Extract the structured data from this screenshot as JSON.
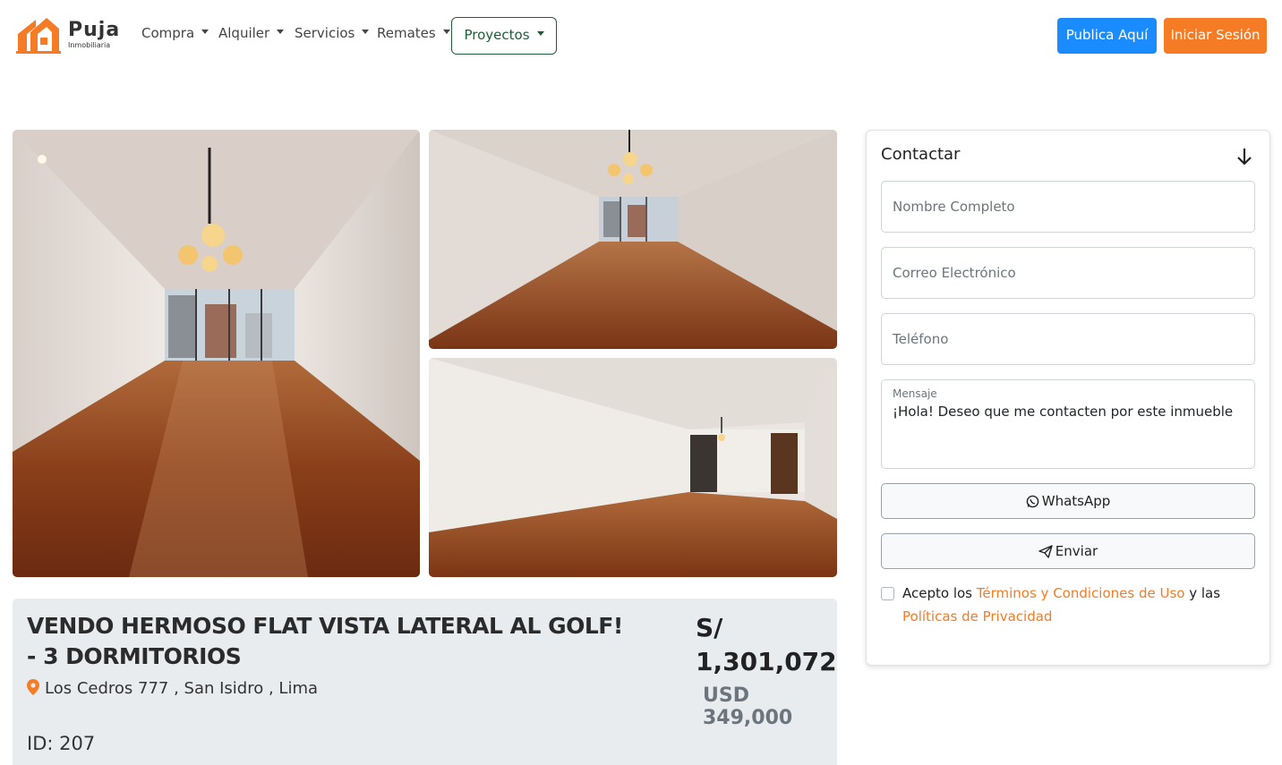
{
  "brand": {
    "name": "Puja",
    "subtitle": "Inmobiliaria"
  },
  "nav": {
    "items": [
      {
        "label": "Compra"
      },
      {
        "label": "Alquiler"
      },
      {
        "label": "Servicios"
      },
      {
        "label": "Remates"
      }
    ],
    "projects_label": "Proyectos",
    "publish_label": "Publica Aquí",
    "login_label": "Iniciar Sesión"
  },
  "colors": {
    "primary_blue": "#1a8cff",
    "accent_orange": "#f57b25",
    "project_green": "#1f5c3a"
  },
  "gallery": {
    "photos": [
      {
        "name": "photo-main",
        "icon": "empty-living-room"
      },
      {
        "name": "photo-top",
        "icon": "empty-living-room"
      },
      {
        "name": "photo-bottom",
        "icon": "empty-living-room"
      }
    ]
  },
  "listing": {
    "title": "VENDO HERMOSO FLAT VISTA LATERAL AL GOLF! - 3 DORMITORIOS",
    "location": "Los Cedros 777 , San Isidro , Lima",
    "price_local": "S/ 1,301,072",
    "price_usd": "USD 349,000",
    "id_label": "ID: 207"
  },
  "contact": {
    "title": "Contactar",
    "name_placeholder": "Nombre Completo",
    "email_placeholder": "Correo Electrónico",
    "phone_placeholder": "Teléfono",
    "message_label": "Mensaje",
    "message_value": "¡Hola! Deseo que me contacten por este inmueble",
    "whatsapp_label": "WhatsApp",
    "send_label": "Enviar",
    "terms_prefix": "Acepto los",
    "terms_link": "Términos y Condiciones de Uso",
    "terms_middle": "y las",
    "privacy_link": "Políticas de Privacidad"
  }
}
